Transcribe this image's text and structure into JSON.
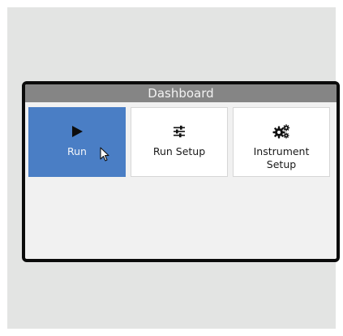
{
  "dashboard": {
    "title": "Dashboard",
    "tiles": [
      {
        "label": "Run",
        "icon": "play-icon",
        "selected": true
      },
      {
        "label": "Run Setup",
        "icon": "sliders-icon",
        "selected": false
      },
      {
        "label": "Instrument\nSetup",
        "icon": "gears-icon",
        "selected": false
      }
    ]
  },
  "colors": {
    "titlebar": "#858585",
    "selected_tile": "#4a7ec5",
    "screen_bg": "#f1f1f1",
    "bezel": "#0b0b0b",
    "backdrop": "#e3e4e3"
  }
}
